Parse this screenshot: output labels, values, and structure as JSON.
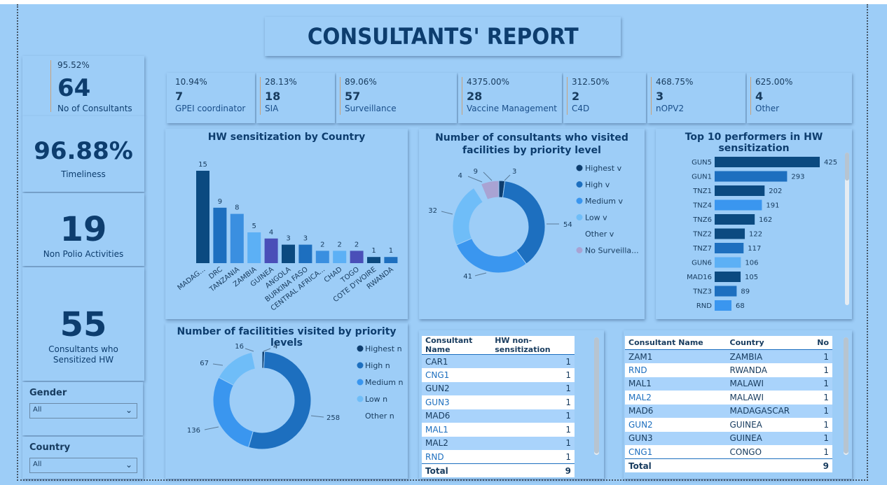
{
  "report_title": "CONSULTANTS' REPORT",
  "kpis": {
    "consultants_pct": "95.52%",
    "consultants_value": "64",
    "consultants_label": "No of Consultants",
    "timeliness_value": "96.88%",
    "timeliness_label": "Timeliness",
    "non_polio_value": "19",
    "non_polio_label": "Non Polio Activities",
    "sensitized_value": "55",
    "sensitized_label": "Consultants who Sensitized HW"
  },
  "categories": [
    {
      "pct": "10.94%",
      "value": "7",
      "label": "GPEI coordinator"
    },
    {
      "pct": "28.13%",
      "value": "18",
      "label": "SIA"
    },
    {
      "pct": "89.06%",
      "value": "57",
      "label": "Surveillance"
    },
    {
      "pct": "4375.00%",
      "value": "28",
      "label": "Vaccine Management"
    },
    {
      "pct": "312.50%",
      "value": "2",
      "label": "C4D"
    },
    {
      "pct": "468.75%",
      "value": "3",
      "label": "nOPV2"
    },
    {
      "pct": "625.00%",
      "value": "4",
      "label": "Other"
    }
  ],
  "slicers": {
    "gender_label": "Gender",
    "gender_value": "All",
    "country_label": "Country",
    "country_value": "All"
  },
  "chart_data": [
    {
      "type": "bar",
      "title": "HW sensitization by Country",
      "categories": [
        "MADAG...",
        "DRC",
        "TANZANIA",
        "ZAMBIA",
        "GUINEA",
        "ANGOLA",
        "BURKINA FASO",
        "CENTRAL AFRICA...",
        "CHAD",
        "TOGO",
        "COTE D'IVOIRE",
        "RWANDA"
      ],
      "values": [
        15,
        9,
        8,
        5,
        4,
        3,
        3,
        2,
        2,
        2,
        1,
        1
      ],
      "colors": [
        "#0b4a80",
        "#1d6fbf",
        "#3a8fe0",
        "#5cb0f5",
        "#4a4fb8",
        "#0b4a80",
        "#1d6fbf",
        "#3a8fe0",
        "#5cb0f5",
        "#4a4fb8",
        "#0b4a80",
        "#1d6fbf"
      ]
    },
    {
      "type": "pie",
      "title": "Number of consultants who visited facilities by priority level",
      "labels": [
        "Highest v",
        "High v",
        "Medium v",
        "Low v",
        "Other v",
        "No Surveilla..."
      ],
      "values": [
        3,
        54,
        41,
        32,
        4,
        9
      ],
      "colors": [
        "#0d3d6e",
        "#1d6fbf",
        "#3a96ef",
        "#6fbdf8",
        "#9dcdf7",
        "#a9a3d3"
      ]
    },
    {
      "type": "bar",
      "orientation": "horizontal",
      "title": "Top 10 performers in HW sensitization",
      "categories": [
        "GUN5",
        "GUN1",
        "TNZ1",
        "TNZ4",
        "TNZ6",
        "TNZ2",
        "TNZ7",
        "GUN6",
        "MAD16",
        "TNZ3",
        "RND"
      ],
      "values": [
        425,
        293,
        202,
        191,
        162,
        122,
        117,
        106,
        105,
        89,
        68
      ],
      "colors": [
        "#0b4a80",
        "#1d6fbf",
        "#0b4a80",
        "#3a96ef",
        "#0b4a80",
        "#0b4a80",
        "#1d6fbf",
        "#5cb0f5",
        "#0b4a80",
        "#1d6fbf",
        "#3a96ef"
      ]
    },
    {
      "type": "pie",
      "title": "Number of facilitities visited by priority levels",
      "labels": [
        "Highest n",
        "High n",
        "Medium n",
        "Low n",
        "Other n"
      ],
      "values": [
        4,
        258,
        136,
        67,
        16
      ],
      "colors": [
        "#0d3d6e",
        "#1d6fbf",
        "#3a96ef",
        "#6fbdf8",
        "#9dcdf7"
      ]
    }
  ],
  "table1": {
    "headers": [
      "Consultant Name",
      "HW non-sensitization"
    ],
    "rows": [
      [
        "CAR1",
        "1"
      ],
      [
        "CNG1",
        "1"
      ],
      [
        "GUN2",
        "1"
      ],
      [
        "GUN3",
        "1"
      ],
      [
        "MAD6",
        "1"
      ],
      [
        "MAL1",
        "1"
      ],
      [
        "MAL2",
        "1"
      ],
      [
        "RND",
        "1"
      ]
    ],
    "total_label": "Total",
    "total_value": "9"
  },
  "table2": {
    "headers": [
      "Consultant Name",
      "Country",
      "No"
    ],
    "rows": [
      [
        "ZAM1",
        "ZAMBIA",
        "1"
      ],
      [
        "RND",
        "RWANDA",
        "1"
      ],
      [
        "MAL1",
        "MALAWI",
        "1"
      ],
      [
        "MAL2",
        "MALAWI",
        "1"
      ],
      [
        "MAD6",
        "MADAGASCAR",
        "1"
      ],
      [
        "GUN2",
        "GUINEA",
        "1"
      ],
      [
        "GUN3",
        "GUINEA",
        "1"
      ],
      [
        "CNG1",
        "CONGO",
        "1"
      ]
    ],
    "total_label": "Total",
    "total_value": "9"
  }
}
